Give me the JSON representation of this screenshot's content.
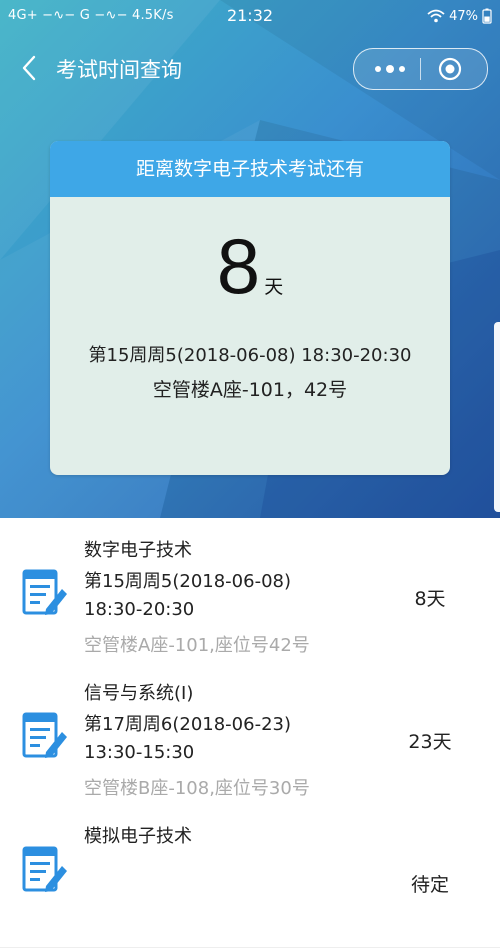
{
  "status_bar": {
    "network": "4G+ −∿− G −∿− 4.5K/s",
    "time": "21:32",
    "battery": "47%"
  },
  "nav": {
    "title": "考试时间查询"
  },
  "countdown": {
    "header": "距离数字电子技术考试还有",
    "days": "8",
    "unit": "天",
    "when": "第15周周5(2018-06-08) 18:30-20:30",
    "where": "空管楼A座-101，42号"
  },
  "exams": [
    {
      "name": "数字电子技术",
      "week_date": "第15周周5(2018-06-08)",
      "time": "18:30-20:30",
      "location": "空管楼A座-101,座位号42号",
      "days": "8天"
    },
    {
      "name": "信号与系统(I)",
      "week_date": "第17周周6(2018-06-23)",
      "time": "13:30-15:30",
      "location": "空管楼B座-108,座位号30号",
      "days": "23天"
    },
    {
      "name": "模拟电子技术",
      "days": "待定"
    }
  ],
  "colors": {
    "accent": "#3ea7e7",
    "card_bg": "#e1eee9",
    "icon_blue": "#2c8fe0"
  }
}
